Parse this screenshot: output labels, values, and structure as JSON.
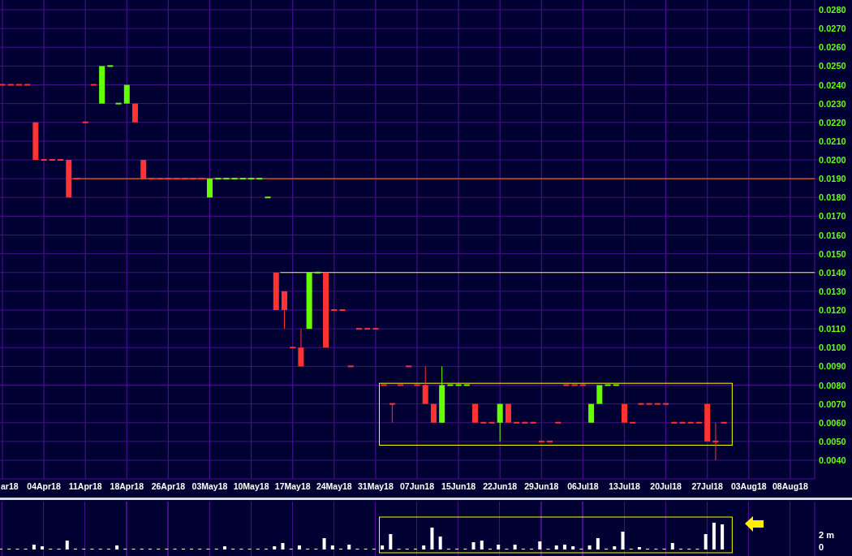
{
  "price_axis": {
    "labels": [
      "0.0280",
      "0.0270",
      "0.0260",
      "0.0250",
      "0.0240",
      "0.0230",
      "0.0220",
      "0.0210",
      "0.0200",
      "0.0190",
      "0.0180",
      "0.0170",
      "0.0160",
      "0.0150",
      "0.0140",
      "0.0130",
      "0.0120",
      "0.0110",
      "0.0100",
      "0.0090",
      "0.0080",
      "0.0070",
      "0.0060",
      "0.0050",
      "0.0040"
    ]
  },
  "date_axis": {
    "labels": [
      "ar18",
      "04Apr18",
      "11Apr18",
      "18Apr18",
      "26Apr18",
      "03May18",
      "10May18",
      "17May18",
      "24May18",
      "31May18",
      "07Jun18",
      "15Jun18",
      "22Jun18",
      "29Jun18",
      "06Jul18",
      "13Jul18",
      "20Jul18",
      "27Jul18",
      "03Aug18",
      "08Aug18"
    ]
  },
  "volume_axis": {
    "labels": [
      "2 m",
      "0"
    ]
  }
}
